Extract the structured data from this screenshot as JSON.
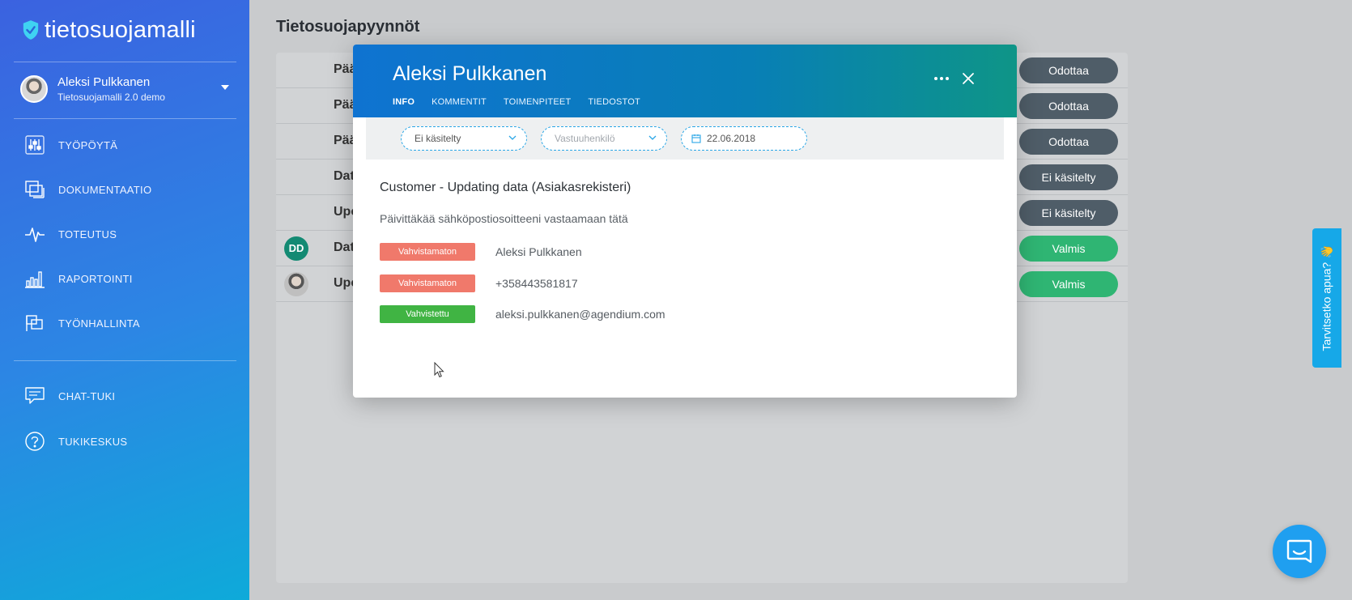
{
  "sidebar": {
    "logo": "tietosuojamalli",
    "user": {
      "name": "Aleksi Pulkkanen",
      "org": "Tietosuojamalli 2.0 demo"
    },
    "nav": [
      {
        "label": "TYÖPÖYTÄ",
        "icon": "sliders-icon"
      },
      {
        "label": "DOKUMENTAATIO",
        "icon": "documents-icon"
      },
      {
        "label": "TOTEUTUS",
        "icon": "activity-icon"
      },
      {
        "label": "RAPORTOINTI",
        "icon": "bar-chart-icon"
      },
      {
        "label": "TYÖNHALLINTA",
        "icon": "task-icon"
      }
    ],
    "support": [
      {
        "label": "CHAT-TUKI",
        "icon": "chat-icon"
      },
      {
        "label": "TUKIKESKUS",
        "icon": "help-circle-icon"
      }
    ]
  },
  "main": {
    "title": "Tietosuojapyynnöt",
    "rows": [
      {
        "text": "Pää",
        "status": "Odottaa",
        "avatar": ""
      },
      {
        "text": "Pää",
        "status": "Odottaa",
        "avatar": ""
      },
      {
        "text": "Pää",
        "status": "Odottaa",
        "avatar": ""
      },
      {
        "text": "Dat",
        "status": "Ei käsitelty",
        "avatar": ""
      },
      {
        "text": "Upc",
        "status": "Ei käsitelty",
        "avatar": ""
      },
      {
        "text": "Dat",
        "status": "Valmis",
        "avatar": "DD"
      },
      {
        "text": "Upc",
        "status": "Valmis",
        "avatar": "photo"
      }
    ]
  },
  "modal": {
    "title": "Aleksi Pulkkanen",
    "tabs": [
      "INFO",
      "KOMMENTIT",
      "TOIMENPITEET",
      "TIEDOSTOT"
    ],
    "filters": {
      "status": "Ei käsitelty",
      "assignee_placeholder": "Vastuuhenkilö",
      "date": "22.06.2018"
    },
    "request_title": "Customer - Updating data (Asiakasrekisteri)",
    "request_description": "Päivittäkää sähköpostiosoitteeni vastaamaan tätä",
    "fields": [
      {
        "badge": "Vahvistamaton",
        "value": "Aleksi Pulkkanen",
        "badge_color": "#f0796b"
      },
      {
        "badge": "Vahvistamaton",
        "value": "+358443581817",
        "badge_color": "#f0796b"
      },
      {
        "badge": "Vahvistettu",
        "value": "aleksi.pulkkanen@agendium.com",
        "badge_color": "#40b443"
      }
    ]
  },
  "help_tab": "Tarvitsetko apua? 👋",
  "colors": {
    "accent": "#16a8e8",
    "waiting": "#4f5d68",
    "done": "#2fb573"
  }
}
